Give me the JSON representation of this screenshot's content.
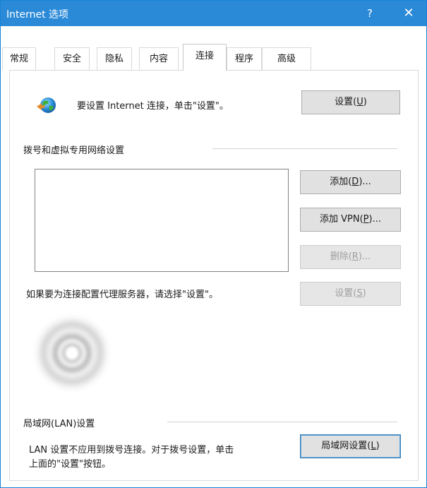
{
  "window": {
    "title": "Internet 选项",
    "help_label": "?",
    "close_label": "✕"
  },
  "tabs": [
    {
      "label": "常规",
      "active": false
    },
    {
      "label": "安全",
      "active": false
    },
    {
      "label": "隐私",
      "active": false
    },
    {
      "label": "内容",
      "active": false
    },
    {
      "label": "连接",
      "active": true
    },
    {
      "label": "程序",
      "active": false
    },
    {
      "label": "高级",
      "active": false
    }
  ],
  "setup": {
    "text": "要设置 Internet 连接，单击\"设置\"。",
    "button": {
      "prefix": "设置(",
      "mnemonic": "U",
      "suffix": ")"
    }
  },
  "dialup": {
    "heading": "拨号和虚拟专用网络设置",
    "connections": [],
    "add_button": {
      "prefix": "添加(",
      "mnemonic": "D",
      "suffix": ")..."
    },
    "add_vpn_button": {
      "prefix": "添加 VPN(",
      "mnemonic": "P",
      "suffix": ")..."
    },
    "delete_button": {
      "prefix": "删除(",
      "mnemonic": "R",
      "suffix": ")...",
      "disabled": true
    },
    "proxy_text": "如果要为连接配置代理服务器，请选择\"设置\"。",
    "settings_button": {
      "prefix": "设置(",
      "mnemonic": "S",
      "suffix": ")",
      "disabled": true
    }
  },
  "lan": {
    "heading": "局域网(LAN)设置",
    "text_line1": "LAN 设置不应用到拨号连接。对于拨号设置，单击",
    "text_line2": "上面的\"设置\"按钮。",
    "button": {
      "prefix": "局域网设置(",
      "mnemonic": "L",
      "suffix": ")"
    }
  },
  "colors": {
    "titlebar": "#2b8ad8",
    "accent_border": "#1883d7"
  }
}
